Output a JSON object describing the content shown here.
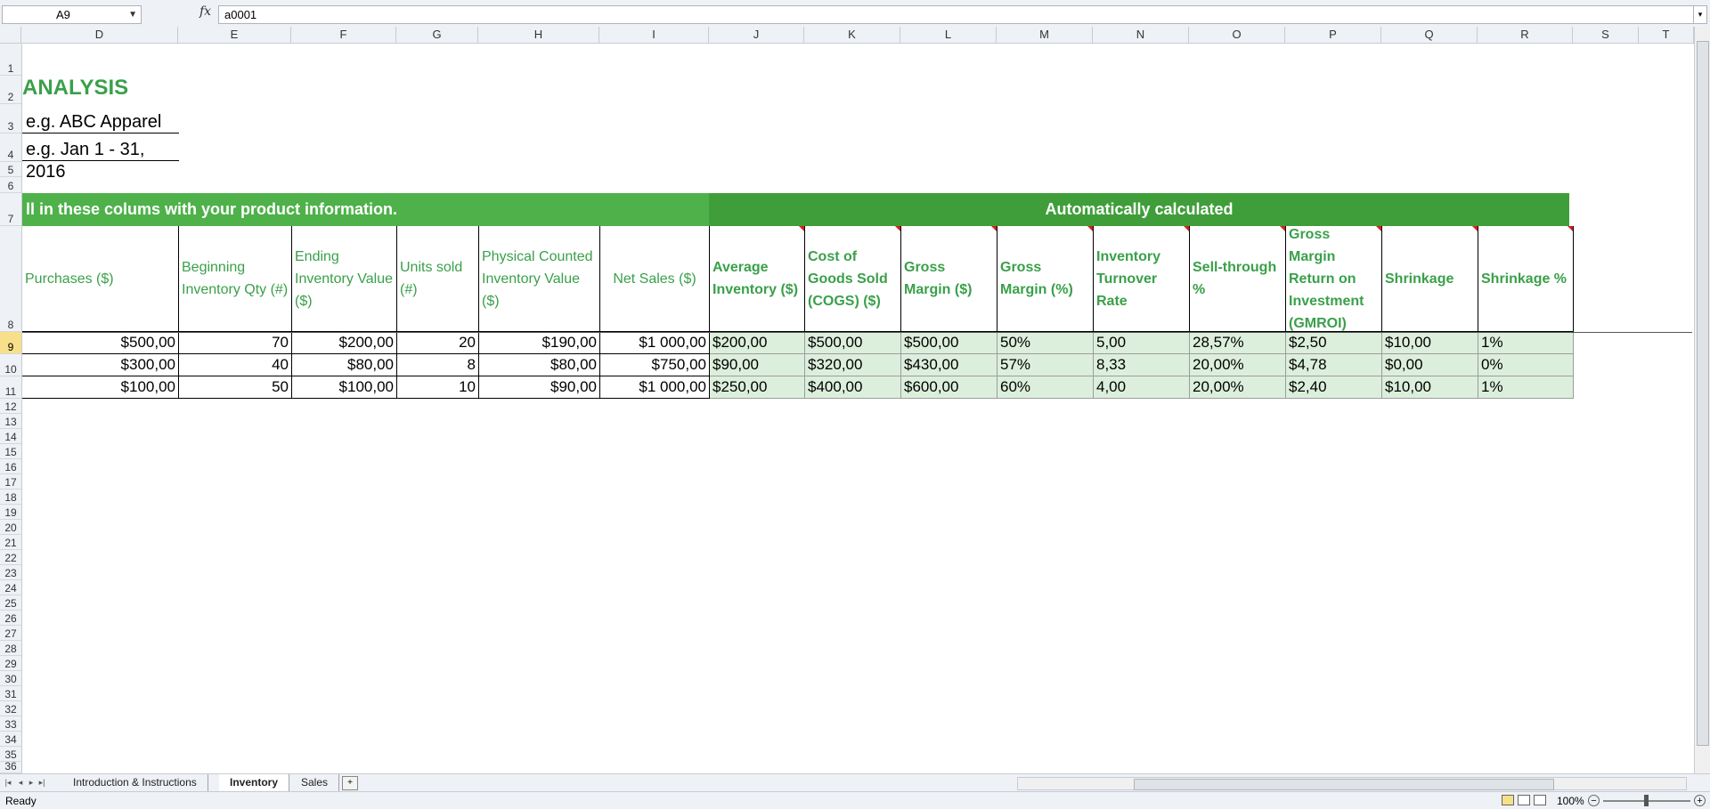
{
  "formula_bar": {
    "name_box": "A9",
    "fx_label": "fx",
    "formula": "a0001"
  },
  "columns": [
    "D",
    "E",
    "F",
    "G",
    "H",
    "I",
    "J",
    "K",
    "L",
    "M",
    "N",
    "O",
    "P",
    "Q",
    "R",
    "S",
    "T"
  ],
  "rows": [
    "1",
    "2",
    "3",
    "4",
    "5",
    "6",
    "7",
    "8",
    "9",
    "10",
    "11",
    "12",
    "13",
    "14",
    "15",
    "16",
    "17",
    "18",
    "19",
    "20",
    "21",
    "22",
    "23",
    "24",
    "25",
    "26",
    "27",
    "28",
    "29",
    "30",
    "31",
    "32",
    "33",
    "34",
    "35",
    "36"
  ],
  "sheet": {
    "title": "ANALYSIS",
    "company": "e.g. ABC Apparel",
    "period": "e.g. Jan 1 - 31, 2016",
    "band_left": "ll in these colums with your product information.",
    "band_right": "Automatically calculated",
    "headers": [
      "Purchases ($)",
      "Beginning Inventory Qty (#)",
      "Ending Inventory Value ($)",
      "Units sold (#)",
      "Physical Counted Inventory Value ($)",
      "Net Sales ($)",
      "Average Inventory ($)",
      "Cost of Goods Sold (COGS) ($)",
      "Gross Margin ($)",
      "Gross Margin (%)",
      "Inventory Turnover Rate",
      "Sell-through %",
      "Gross Margin Return on Investment (GMROI)",
      "Shrinkage",
      "Shrinkage %"
    ],
    "data_rows": [
      [
        "$500,00",
        "70",
        "$200,00",
        "20",
        "$190,00",
        "$1 000,00",
        "$200,00",
        "$500,00",
        "$500,00",
        "50%",
        "5,00",
        "28,57%",
        "$2,50",
        "$10,00",
        "1%"
      ],
      [
        "$300,00",
        "40",
        "$80,00",
        "8",
        "$80,00",
        "$750,00",
        "$90,00",
        "$320,00",
        "$430,00",
        "57%",
        "8,33",
        "20,00%",
        "$4,78",
        "$0,00",
        "0%"
      ],
      [
        "$100,00",
        "50",
        "$100,00",
        "10",
        "$90,00",
        "$1 000,00",
        "$250,00",
        "$400,00",
        "$600,00",
        "60%",
        "4,00",
        "20,00%",
        "$2,40",
        "$10,00",
        "1%"
      ]
    ]
  },
  "tabs": [
    "Introduction & Instructions",
    "Inventory",
    "Sales"
  ],
  "active_tab": "Inventory",
  "status": {
    "text": "Ready",
    "zoom": "100%"
  },
  "icons": [
    "name-box-dropdown-icon",
    "fx-icon",
    "sheet-nav-first-icon",
    "sheet-nav-prev-icon",
    "sheet-nav-next-icon",
    "sheet-nav-last-icon",
    "new-sheet-icon",
    "normal-view-icon",
    "page-layout-view-icon",
    "page-break-view-icon",
    "zoom-out-icon",
    "zoom-in-icon"
  ]
}
